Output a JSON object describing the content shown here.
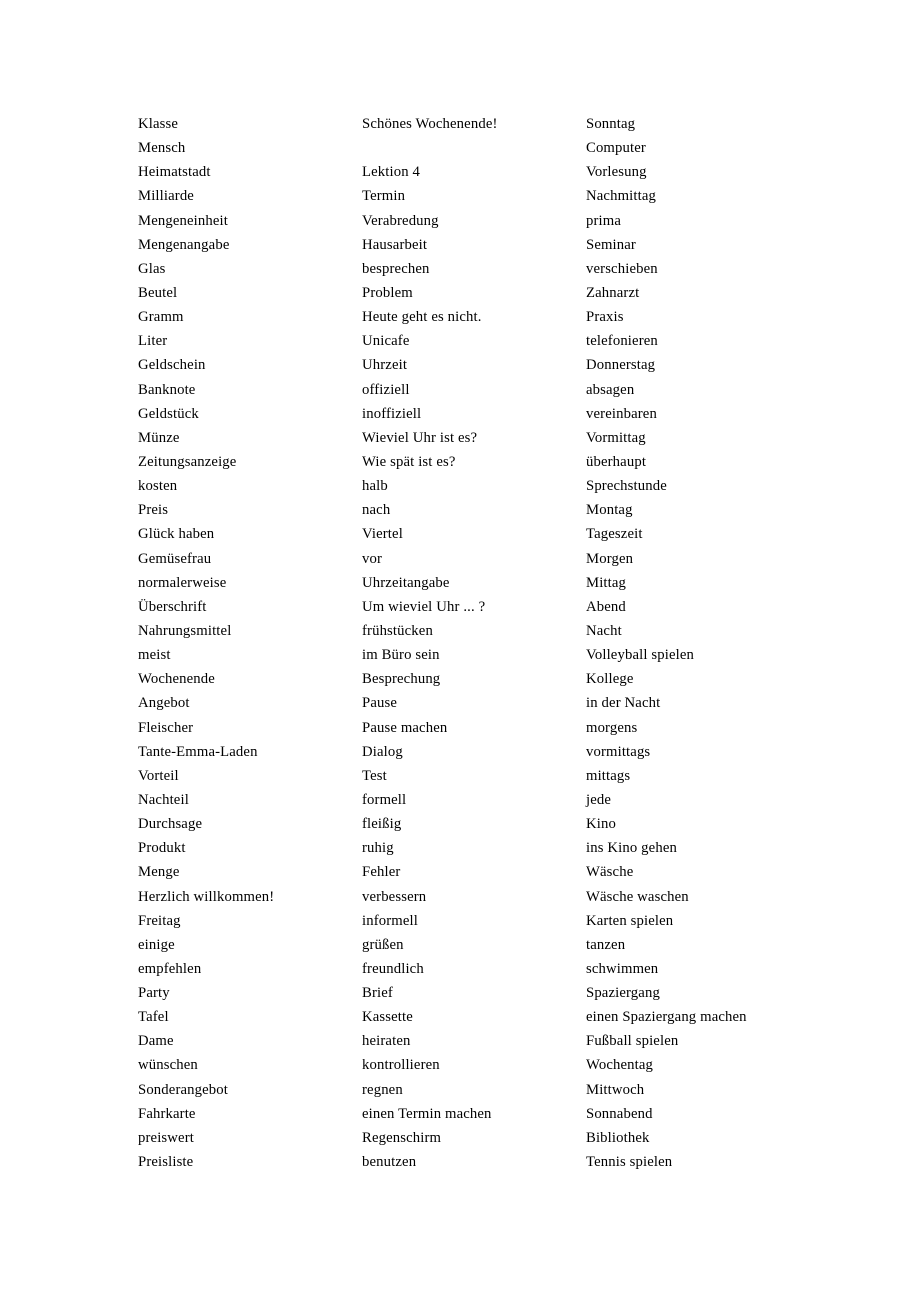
{
  "document": {
    "type": "vocabulary-word-list",
    "language": "German",
    "columns": 3,
    "rows": 43,
    "text_color": "#000000",
    "background_color": "#ffffff"
  },
  "columns": [
    {
      "name": "column-1",
      "entries": [
        "Klasse",
        "Mensch",
        "Heimatstadt",
        "Milliarde",
        "Mengeneinheit",
        "Mengenangabe",
        "Glas",
        "Beutel",
        "Gramm",
        "Liter",
        "Geldschein",
        "Banknote",
        "Geldstück",
        "Münze",
        "Zeitungsanzeige",
        "kosten",
        "Preis",
        "Glück haben",
        "Gemüsefrau",
        "normalerweise",
        "Überschrift",
        "Nahrungsmittel",
        "meist",
        "Wochenende",
        "Angebot",
        "Fleischer",
        "Tante-Emma-Laden",
        "Vorteil",
        "Nachteil",
        "Durchsage",
        "Produkt",
        "Menge",
        "Herzlich willkommen!",
        "Freitag",
        "einige",
        "empfehlen",
        "Party",
        "Tafel",
        "Dame",
        "wünschen",
        "Sonderangebot",
        "Fahrkarte",
        "preiswert",
        "Preisliste"
      ]
    },
    {
      "name": "column-2",
      "entries": [
        "Schönes Wochenende!",
        "",
        "Lektion 4",
        "Termin",
        "Verabredung",
        "Hausarbeit",
        "besprechen",
        "Problem",
        "Heute geht es nicht.",
        "Unicafe",
        "Uhrzeit",
        "offiziell",
        "inoffiziell",
        "Wieviel Uhr ist es?",
        "Wie spät ist es?",
        "halb",
        "nach",
        "Viertel",
        "vor",
        "Uhrzeitangabe",
        "Um wieviel Uhr ... ?",
        "frühstücken",
        "im Büro sein",
        "Besprechung",
        "Pause",
        "Pause machen",
        "Dialog",
        "Test",
        "formell",
        "fleißig",
        "ruhig",
        "Fehler",
        "verbessern",
        "informell",
        "grüßen",
        "freundlich",
        "Brief",
        "Kassette",
        "heiraten",
        "kontrollieren",
        "regnen",
        "einen Termin machen",
        "Regenschirm",
        "benutzen"
      ]
    },
    {
      "name": "column-3",
      "entries": [
        "Sonntag",
        "Computer",
        "Vorlesung",
        "Nachmittag",
        "prima",
        "Seminar",
        "verschieben",
        "Zahnarzt",
        "Praxis",
        "telefonieren",
        "Donnerstag",
        "absagen",
        "vereinbaren",
        "Vormittag",
        "überhaupt",
        "Sprechstunde",
        "Montag",
        "Tageszeit",
        "Morgen",
        "Mittag",
        "Abend",
        "Nacht",
        "Volleyball spielen",
        "Kollege",
        "in der Nacht",
        "morgens",
        "vormittags",
        "mittags",
        "jede",
        "Kino",
        "ins Kino gehen",
        "Wäsche",
        "Wäsche waschen",
        "Karten spielen",
        "tanzen",
        "schwimmen",
        "Spaziergang",
        "einen Spaziergang machen",
        "Fußball spielen",
        "Wochentag",
        "Mittwoch",
        "Sonnabend",
        "Bibliothek",
        "Tennis spielen"
      ]
    }
  ]
}
